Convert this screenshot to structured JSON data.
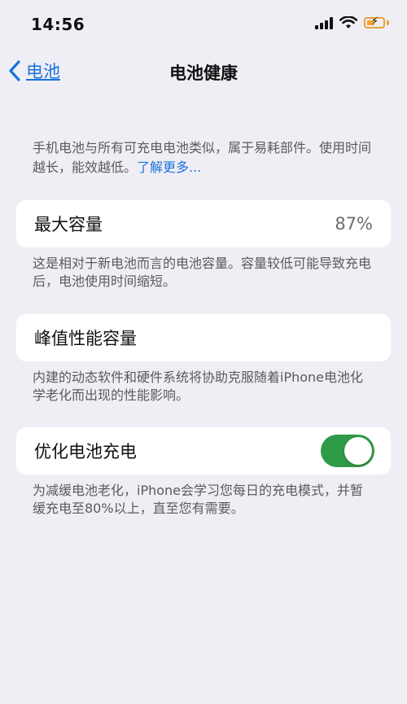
{
  "status_bar": {
    "time": "14:56",
    "icons": [
      "signal-icon",
      "wifi-icon",
      "battery-charging-icon"
    ],
    "battery_color": "#e8a23a"
  },
  "nav": {
    "back_label": "电池",
    "title": "电池健康"
  },
  "intro": {
    "text": "手机电池与所有可充电电池类似，属于易耗部件。使用时间越长，能效越低。",
    "link": "了解更多..."
  },
  "max_capacity": {
    "label": "最大容量",
    "value": "87%",
    "desc": "这是相对于新电池而言的电池容量。容量较低可能导致充电后，电池使用时间缩短。"
  },
  "peak_performance": {
    "label": "峰值性能容量",
    "desc": "内建的动态软件和硬件系统将协助克服随着iPhone电池化学老化而出现的性能影响。"
  },
  "optimized_charging": {
    "label": "优化电池充电",
    "enabled": true,
    "toggle_color": "#2f9a47",
    "desc": "为减缓电池老化，iPhone会学习您每日的充电模式，并暂缓充电至80%以上，直至您有需要。"
  },
  "accent_color": "#1a73d9"
}
